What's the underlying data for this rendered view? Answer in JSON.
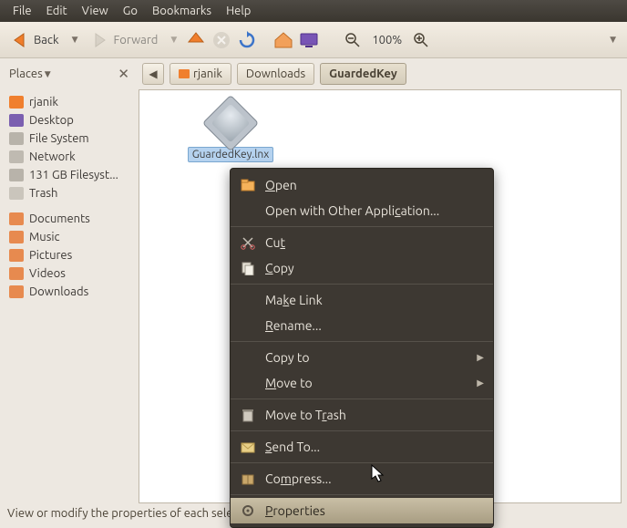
{
  "menubar": [
    "File",
    "Edit",
    "View",
    "Go",
    "Bookmarks",
    "Help"
  ],
  "toolbar": {
    "back": "Back",
    "forward": "Forward",
    "zoom": "100%"
  },
  "places_header": "Places",
  "breadcrumbs": [
    {
      "label": "rjanik",
      "home": true
    },
    {
      "label": "Downloads"
    },
    {
      "label": "GuardedKey",
      "active": true
    }
  ],
  "sidebar": {
    "top": [
      {
        "label": "rjanik",
        "ic": "home"
      },
      {
        "label": "Desktop",
        "ic": "desk"
      },
      {
        "label": "File System",
        "ic": "drv"
      },
      {
        "label": "Network",
        "ic": "net"
      },
      {
        "label": "131 GB Filesyst...",
        "ic": "drv"
      },
      {
        "label": "Trash",
        "ic": "trash"
      }
    ],
    "bottom": [
      {
        "label": "Documents",
        "ic": "doc"
      },
      {
        "label": "Music",
        "ic": "doc"
      },
      {
        "label": "Pictures",
        "ic": "doc"
      },
      {
        "label": "Videos",
        "ic": "doc"
      },
      {
        "label": "Downloads",
        "ic": "doc"
      }
    ]
  },
  "file": {
    "name": "GuardedKey.lnx"
  },
  "context_menu": [
    {
      "label": "Open",
      "u": 0,
      "icon": "open"
    },
    {
      "label": "Open with Other Application...",
      "u": 21
    },
    {
      "sep": true
    },
    {
      "label": "Cut",
      "u": 2,
      "icon": "cut"
    },
    {
      "label": "Copy",
      "u": 0,
      "icon": "copy"
    },
    {
      "sep": true
    },
    {
      "label": "Make Link",
      "u": 2,
      "ul": 5
    },
    {
      "label": "Rename...",
      "u": 0
    },
    {
      "sep": true
    },
    {
      "label": "Copy to",
      "sub": true
    },
    {
      "label": "Move to",
      "u": 0,
      "sub": true
    },
    {
      "sep": true
    },
    {
      "label": "Move to Trash",
      "u": 9,
      "icon": "trash"
    },
    {
      "sep": true
    },
    {
      "label": "Send To...",
      "u": 0,
      "icon": "send"
    },
    {
      "sep": true
    },
    {
      "label": "Compress...",
      "u": 2,
      "icon": "pkg"
    },
    {
      "sep": true
    },
    {
      "label": "Properties",
      "u": 0,
      "icon": "gear",
      "hl": true
    }
  ],
  "status": "View or modify the properties of each selected item"
}
